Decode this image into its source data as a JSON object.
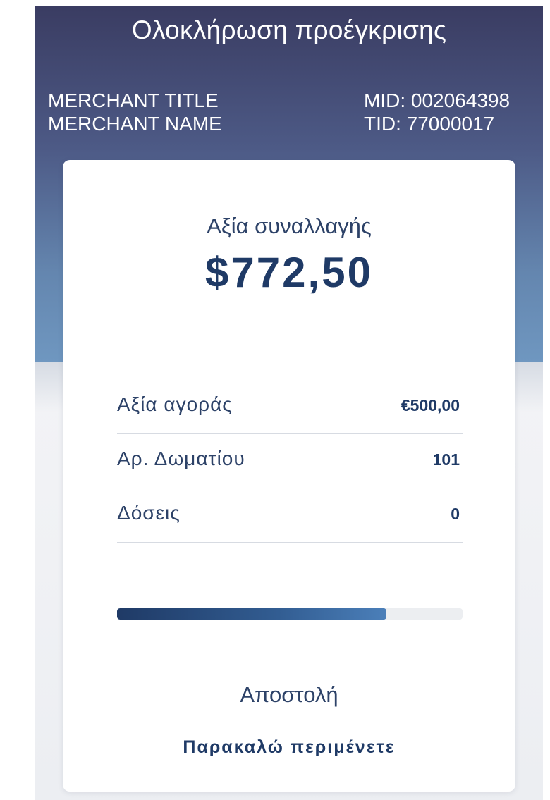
{
  "header": {
    "title": "Ολοκλήρωση προέγκρισης",
    "merchant_title": "MERCHANT TITLE",
    "merchant_name": "MERCHANT NAME",
    "mid": "MID: 002064398",
    "tid": "TID: 77000017"
  },
  "transaction": {
    "amount_label": "Αξία συναλλαγής",
    "amount_value": "$772,50"
  },
  "details": [
    {
      "label": "Αξία αγοράς",
      "value": "€500,00"
    },
    {
      "label": "Αρ. Δωματίου",
      "value": "101"
    },
    {
      "label": "Δόσεις",
      "value": "0"
    }
  ],
  "progress": {
    "percent": 78
  },
  "status": {
    "text": "Αποστολή",
    "wait": "Παρακαλώ περιμένετε"
  },
  "colors": {
    "header_top": "#3a3c62",
    "header_bottom": "#6f97c0",
    "accent": "#1f3a66"
  }
}
